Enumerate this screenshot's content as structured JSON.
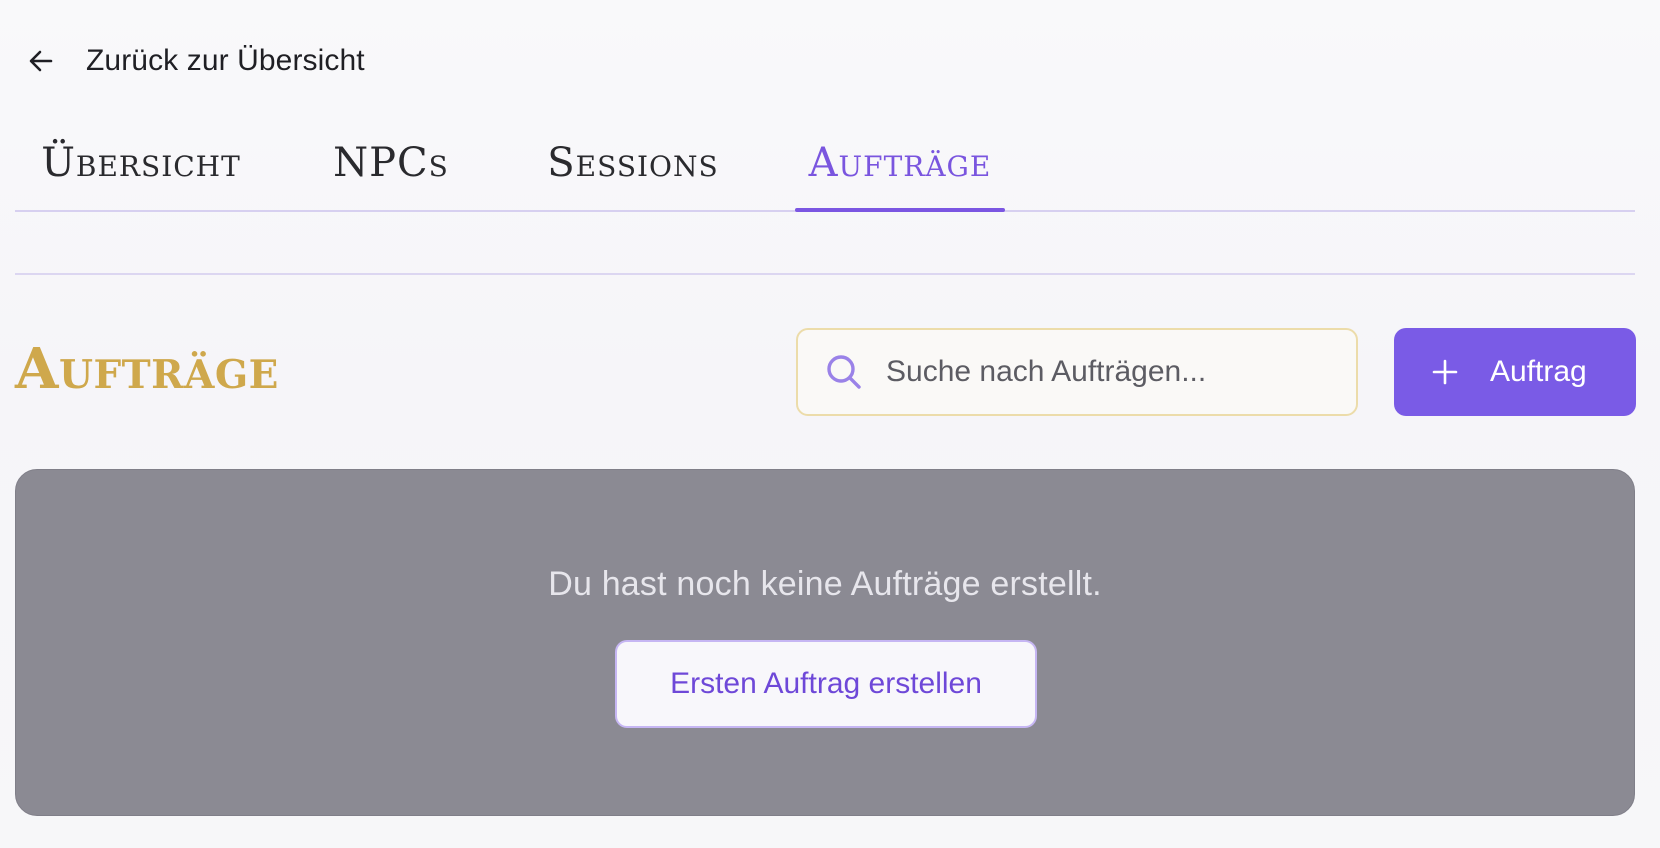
{
  "back": {
    "label": "Zurück zur Übersicht",
    "icon": "arrow-left-icon"
  },
  "tabs": [
    {
      "label": "Übersicht",
      "active": false
    },
    {
      "label": "NPCs",
      "active": false
    },
    {
      "label": "Sessions",
      "active": false
    },
    {
      "label": "Aufträge",
      "active": true
    }
  ],
  "section": {
    "title": "Aufträge"
  },
  "search": {
    "placeholder": "Suche nach Aufträgen...",
    "value": "",
    "icon": "search-icon"
  },
  "add_button": {
    "label": "Auftrag",
    "icon": "plus-icon"
  },
  "empty_state": {
    "message": "Du hast noch keine Aufträge erstellt.",
    "action_label": "Ersten Auftrag erstellen"
  },
  "colors": {
    "accent": "#7a5be6",
    "active_tab": "#7a55df",
    "section_title": "#cfa84c",
    "search_border": "#ecdcaa",
    "panel_bg": "#8b8a93"
  }
}
